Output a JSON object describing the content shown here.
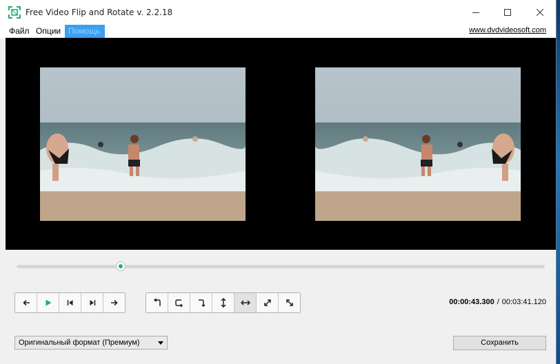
{
  "window": {
    "title": "Free Video Flip and Rotate v. 2.2.18",
    "icons": {
      "app": "app-icon",
      "minimize": "minimize-icon",
      "maximize": "maximize-icon",
      "close": "close-icon"
    }
  },
  "menu": {
    "items": [
      {
        "label": "Файл"
      },
      {
        "label": "Опции"
      },
      {
        "label": "Помощь"
      }
    ],
    "site_link": "www.dvdvideosoft.com",
    "active_color": "#3c9ff0"
  },
  "player": {
    "progress_fraction": 0.197,
    "current_time": "00:00:43.300",
    "separator": "/",
    "total_time": "00:03:41.120",
    "accent_color": "#1db16b"
  },
  "playback_controls": [
    {
      "icon": "step-back-icon"
    },
    {
      "icon": "play-icon"
    },
    {
      "icon": "skip-to-start-icon"
    },
    {
      "icon": "skip-to-end-icon"
    },
    {
      "icon": "step-forward-icon"
    }
  ],
  "transform_controls": [
    {
      "icon": "rotate-left-icon"
    },
    {
      "icon": "rotate-180-icon"
    },
    {
      "icon": "rotate-right-icon"
    },
    {
      "icon": "flip-vertical-icon"
    },
    {
      "icon": "flip-horizontal-icon",
      "pressed": true
    },
    {
      "icon": "transpose-icon"
    },
    {
      "icon": "transverse-icon"
    }
  ],
  "format": {
    "selected": "Оригинальный формат (Премиум)"
  },
  "save_label": "Сохранить"
}
